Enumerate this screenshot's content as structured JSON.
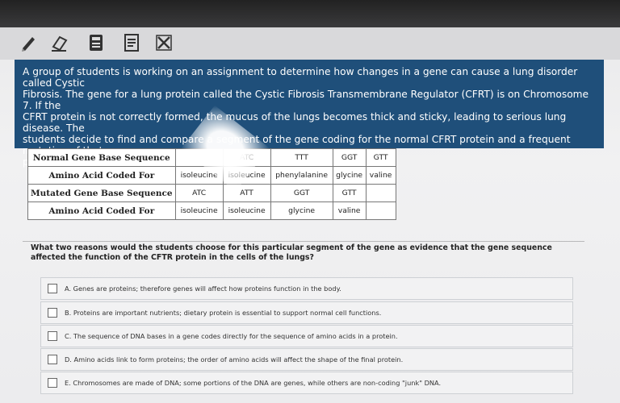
{
  "toolbar": {
    "tools": [
      {
        "name": "pencil-icon"
      },
      {
        "name": "eraser-icon"
      },
      {
        "name": "calculator-icon"
      },
      {
        "name": "reference-sheet-icon"
      },
      {
        "name": "answer-eliminator-icon"
      }
    ]
  },
  "passage": {
    "text": "A group of students is working on an assignment to determine how changes in a gene can cause a lung disorder called Cystic\nFibrosis. The gene for a lung protein called the Cystic Fibrosis Transmembrane Regulator (CFRT) is on Chromosome 7. If the\nCFRT protein is not correctly formed, the mucus of the lungs becomes thick and sticky, leading to serious lung disease. The\nstudents decide to find and compare a segment of the gene coding for the normal CFRT protein and a frequent mutation of that\nprotein, and make a table of the information."
  },
  "table": {
    "rows": [
      {
        "header": "Normal Gene Base Sequence",
        "cells": [
          "",
          "ATC",
          "TTT",
          "GGT",
          "GTT"
        ]
      },
      {
        "header": "Amino Acid Coded For",
        "cells": [
          "isoleucine",
          "isoleucine",
          "phenylalanine",
          "glycine",
          "valine"
        ]
      },
      {
        "header": "Mutated Gene Base Sequence",
        "cells": [
          "ATC",
          "ATT",
          "GGT",
          "GTT",
          ""
        ]
      },
      {
        "header": "Amino Acid Coded For",
        "cells": [
          "isoleucine",
          "isoleucine",
          "glycine",
          "valine",
          ""
        ]
      }
    ]
  },
  "question": {
    "text": "What two reasons would the students choose for this particular segment of the gene as evidence that the gene sequence affected the function of the CFTR protein in the cells of the lungs?"
  },
  "choices": [
    {
      "letter": "A.",
      "text": "A.  Genes are proteins; therefore genes will affect how proteins function in the body."
    },
    {
      "letter": "B.",
      "text": "B.  Proteins are important nutrients; dietary protein is essential to support normal cell functions."
    },
    {
      "letter": "C.",
      "text": "C.  The sequence of DNA bases in a gene codes directly for the sequence of amino acids in a protein."
    },
    {
      "letter": "D.",
      "text": "D.  Amino acids link to form proteins; the order of amino acids will affect the shape of the final protein."
    },
    {
      "letter": "E.",
      "text": "E.  Chromosomes are made of DNA; some portions of the DNA are genes, while others are non-coding \"junk\" DNA."
    }
  ]
}
